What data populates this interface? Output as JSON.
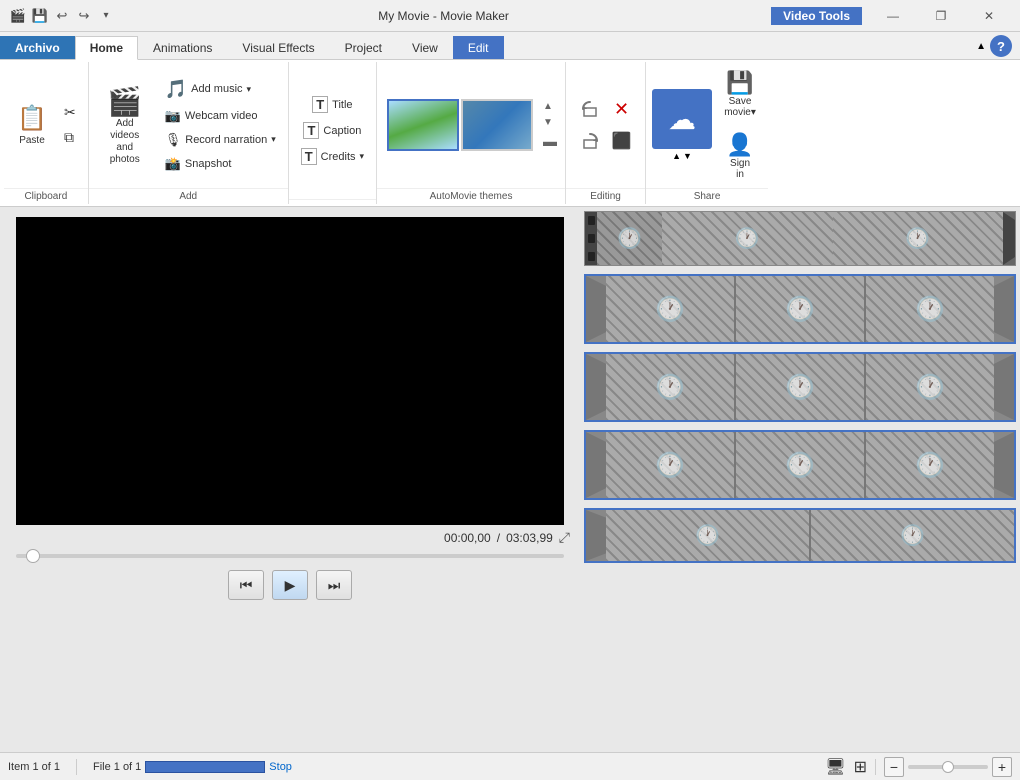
{
  "titlebar": {
    "icons": [
      "💾",
      "↩",
      "↪"
    ],
    "title": "My Movie - Movie Maker",
    "video_tools_label": "Video Tools",
    "min": "—",
    "max": "❐",
    "close": "✕"
  },
  "tabs": [
    {
      "label": "Archivo",
      "active": false,
      "style": "archivo"
    },
    {
      "label": "Home",
      "active": true,
      "style": ""
    },
    {
      "label": "Animations",
      "active": false,
      "style": ""
    },
    {
      "label": "Visual Effects",
      "active": false,
      "style": ""
    },
    {
      "label": "Project",
      "active": false,
      "style": ""
    },
    {
      "label": "View",
      "active": false,
      "style": ""
    },
    {
      "label": "Edit",
      "active": false,
      "style": "edit-tab"
    }
  ],
  "ribbon": {
    "groups": [
      {
        "name": "Clipboard",
        "label": "Clipboard",
        "buttons": [
          {
            "label": "Paste",
            "icon": "📋",
            "large": true
          }
        ],
        "small_buttons": [
          {
            "icon": "✂",
            "label": "Cut"
          },
          {
            "icon": "⧉",
            "label": "Copy"
          }
        ]
      },
      {
        "name": "Add",
        "label": "Add",
        "large_btn": {
          "icon": "🎬",
          "label": "Add videos\nand photos"
        },
        "small_rows": [
          {
            "icon": "🎵",
            "label": "Add music",
            "has_arrow": true
          },
          {
            "icon": "📷",
            "label": "Webcam video"
          },
          {
            "icon": "🎙",
            "label": "Record narration",
            "has_arrow": true
          },
          {
            "icon": "📸",
            "label": "Snapshot"
          }
        ]
      },
      {
        "name": "TextInsert",
        "label": "",
        "text_rows": [
          {
            "icon": "T",
            "label": "Title"
          },
          {
            "icon": "T",
            "label": "Caption"
          },
          {
            "icon": "T",
            "label": "Credits",
            "has_arrow": true
          }
        ]
      },
      {
        "name": "AutoMovieThemes",
        "label": "AutoMovie themes"
      },
      {
        "name": "Editing",
        "label": "Editing",
        "icons": [
          "⛰",
          "✕",
          "⛰",
          "⬛"
        ]
      },
      {
        "name": "Share",
        "label": "Share",
        "save_label": "Save\nmovie",
        "sign_label": "Sign\nin"
      }
    ]
  },
  "player": {
    "time_current": "00:00,00",
    "time_total": "03:03,99",
    "expand_icon": "⤢",
    "prev_frame": "⏮",
    "play": "▶",
    "next_frame": "⏭"
  },
  "timeline": {
    "strips": [
      {
        "type": "first"
      },
      {
        "type": "normal"
      },
      {
        "type": "normal"
      },
      {
        "type": "normal"
      },
      {
        "type": "partial"
      }
    ]
  },
  "statusbar": {
    "item_info": "Item 1 of 1",
    "file_info": "File 1 of 1",
    "stop_label": "Stop",
    "monitor_icon": "🖥",
    "zoom_minus": "−",
    "zoom_plus": "+"
  }
}
